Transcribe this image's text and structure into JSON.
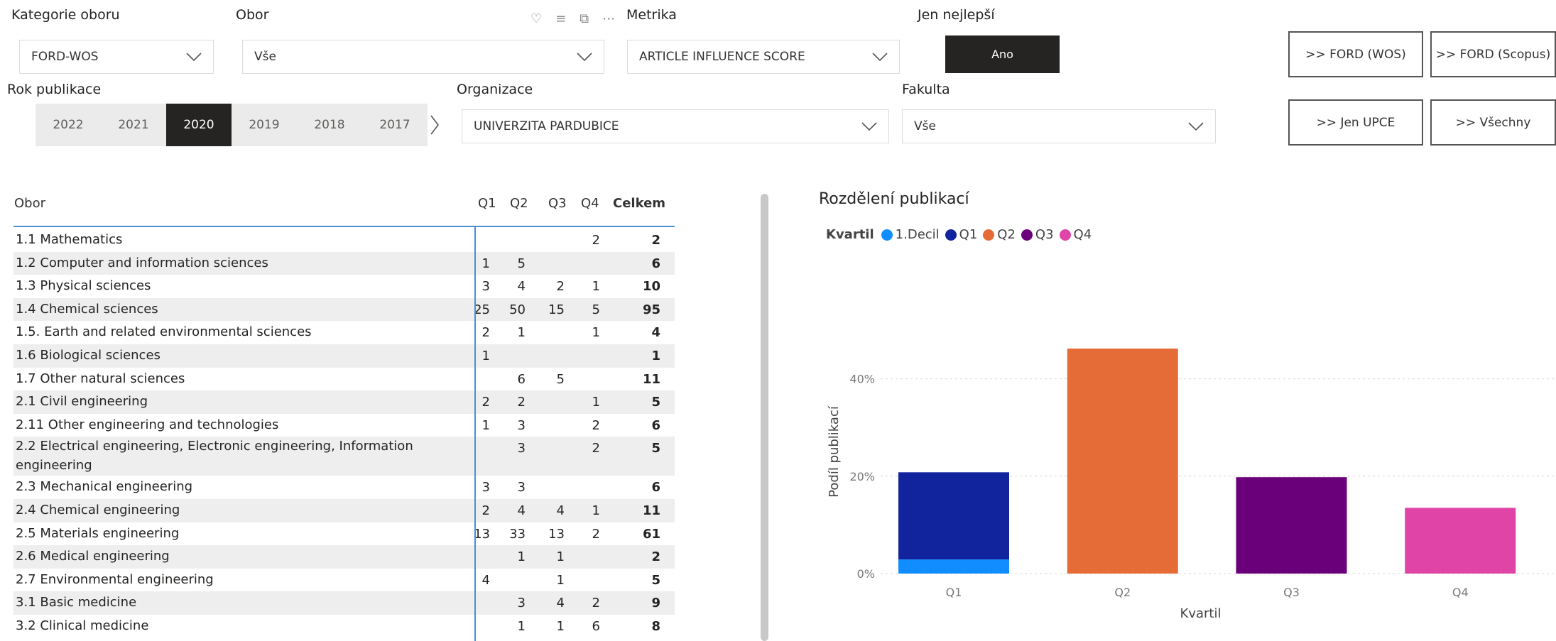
{
  "filters": {
    "kategorie": {
      "label": "Kategorie oboru",
      "value": "FORD-WOS"
    },
    "obor": {
      "label": "Obor",
      "value": "Vše"
    },
    "metrika": {
      "label": "Metrika",
      "value": "ARTICLE INFLUENCE SCORE"
    },
    "jen_nejlepsi": {
      "label": "Jen nejlepší",
      "value": "Ano"
    },
    "rok": {
      "label": "Rok publikace",
      "years": [
        "2022",
        "2021",
        "2020",
        "2019",
        "2018",
        "2017"
      ],
      "selected": "2020"
    },
    "organizace": {
      "label": "Organizace",
      "value": "UNIVERZITA PARDUBICE"
    },
    "fakulta": {
      "label": "Fakulta",
      "value": "Vše"
    }
  },
  "nav_buttons": {
    "ford_wos": ">> FORD (WOS)",
    "ford_scopus": ">> FORD (Scopus)",
    "jen_upce": ">> Jen UPCE",
    "vsechny": ">> Všechny"
  },
  "table": {
    "headers": {
      "obor": "Obor",
      "q1": "Q1",
      "q2": "Q2",
      "q3": "Q3",
      "q4": "Q4",
      "total": "Celkem"
    },
    "rows": [
      {
        "name": "1.1 Mathematics",
        "q1": "",
        "q2": "",
        "q3": "",
        "q4": "2",
        "total": "2"
      },
      {
        "name": "1.2 Computer and information sciences",
        "q1": "1",
        "q2": "5",
        "q3": "",
        "q4": "",
        "total": "6"
      },
      {
        "name": "1.3 Physical sciences",
        "q1": "3",
        "q2": "4",
        "q3": "2",
        "q4": "1",
        "total": "10"
      },
      {
        "name": "1.4 Chemical sciences",
        "q1": "25",
        "q2": "50",
        "q3": "15",
        "q4": "5",
        "total": "95"
      },
      {
        "name": "1.5. Earth and related environmental sciences",
        "q1": "2",
        "q2": "1",
        "q3": "",
        "q4": "1",
        "total": "4"
      },
      {
        "name": "1.6 Biological sciences",
        "q1": "1",
        "q2": "",
        "q3": "",
        "q4": "",
        "total": "1"
      },
      {
        "name": "1.7 Other natural sciences",
        "q1": "",
        "q2": "6",
        "q3": "5",
        "q4": "",
        "total": "11"
      },
      {
        "name": "2.1 Civil engineering",
        "q1": "2",
        "q2": "2",
        "q3": "",
        "q4": "1",
        "total": "5"
      },
      {
        "name": "2.11 Other engineering and technologies",
        "q1": "1",
        "q2": "3",
        "q3": "",
        "q4": "2",
        "total": "6"
      },
      {
        "name": "2.2 Electrical engineering, Electronic engineering, Information engineering",
        "q1": "",
        "q2": "3",
        "q3": "",
        "q4": "2",
        "total": "5"
      },
      {
        "name": "2.3 Mechanical engineering",
        "q1": "3",
        "q2": "3",
        "q3": "",
        "q4": "",
        "total": "6"
      },
      {
        "name": "2.4 Chemical engineering",
        "q1": "2",
        "q2": "4",
        "q3": "4",
        "q4": "1",
        "total": "11"
      },
      {
        "name": "2.5 Materials engineering",
        "q1": "13",
        "q2": "33",
        "q3": "13",
        "q4": "2",
        "total": "61"
      },
      {
        "name": "2.6 Medical engineering",
        "q1": "",
        "q2": "1",
        "q3": "1",
        "q4": "",
        "total": "2"
      },
      {
        "name": "2.7 Environmental engineering",
        "q1": "4",
        "q2": "",
        "q3": "1",
        "q4": "",
        "total": "5"
      },
      {
        "name": "3.1 Basic medicine",
        "q1": "",
        "q2": "3",
        "q3": "4",
        "q4": "2",
        "total": "9"
      },
      {
        "name": "3.2 Clinical medicine",
        "q1": "",
        "q2": "1",
        "q3": "1",
        "q4": "6",
        "total": "8"
      }
    ]
  },
  "chart_title": "Rozdělení publikací",
  "chart_data": {
    "type": "bar",
    "title": "Rozdělení publikací",
    "xlabel": "Kvartil",
    "ylabel": "Podíl publikací",
    "legend_title": "Kvartil",
    "legend": [
      {
        "name": "1.Decil",
        "color": "#118dff"
      },
      {
        "name": "Q1",
        "color": "#12239e"
      },
      {
        "name": "Q2",
        "color": "#e66c37"
      },
      {
        "name": "Q3",
        "color": "#6b007b"
      },
      {
        "name": "Q4",
        "color": "#e044a7"
      }
    ],
    "categories": [
      "Q1",
      "Q2",
      "Q3",
      "Q4"
    ],
    "series": [
      {
        "name": "1.Decil",
        "color": "#118dff",
        "values": [
          2.9,
          0,
          0,
          0
        ]
      },
      {
        "name": "Q1",
        "color": "#12239e",
        "values": [
          17.9,
          0,
          0,
          0
        ]
      },
      {
        "name": "Q2",
        "color": "#e66c37",
        "values": [
          0,
          46.2,
          0,
          0
        ]
      },
      {
        "name": "Q3",
        "color": "#6b007b",
        "values": [
          0,
          0,
          19.8,
          0
        ]
      },
      {
        "name": "Q4",
        "color": "#e044a7",
        "values": [
          0,
          0,
          0,
          13.5
        ]
      }
    ],
    "y_ticks": [
      "0%",
      "20%",
      "40%"
    ],
    "ylim": [
      0,
      50
    ],
    "legend_position": "top-left"
  }
}
